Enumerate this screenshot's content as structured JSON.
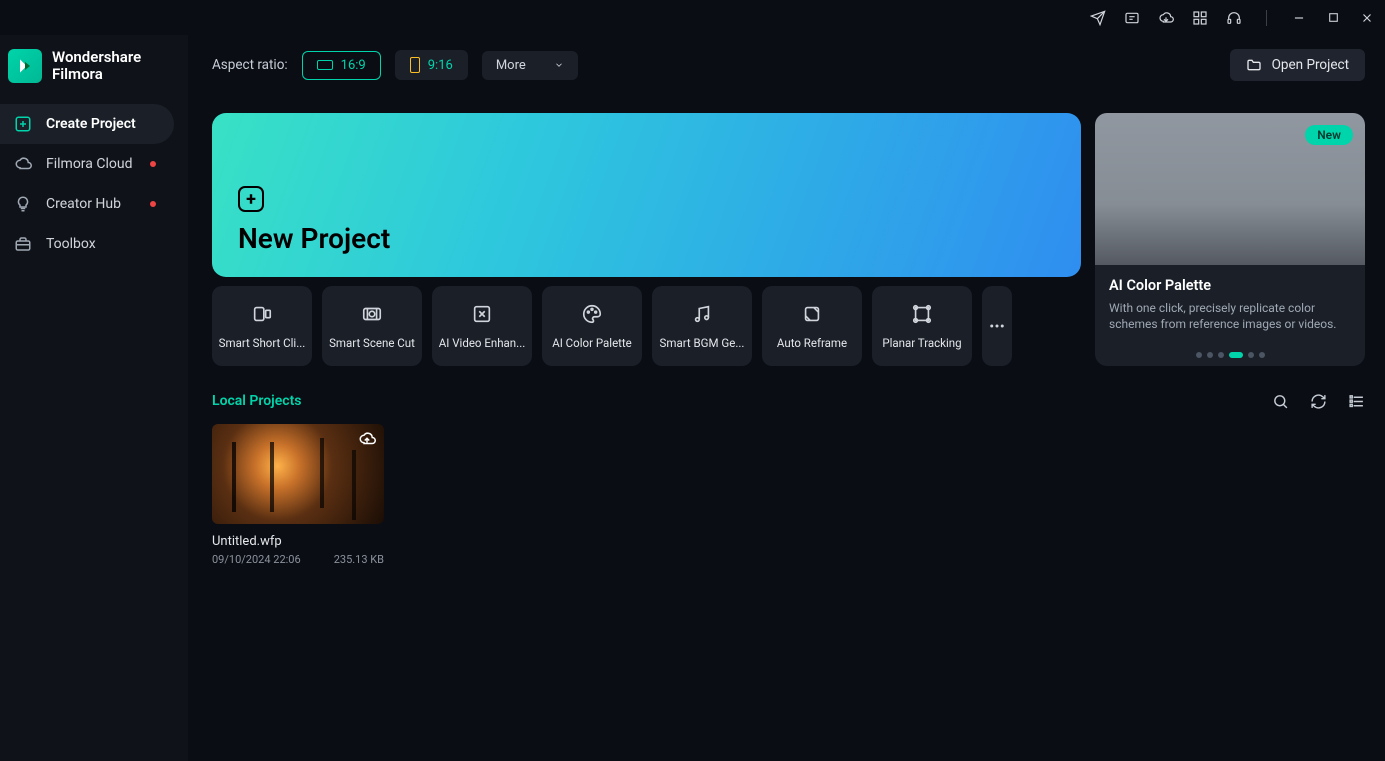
{
  "brand": {
    "line1": "Wondershare",
    "line2": "Filmora"
  },
  "sidebar": {
    "items": [
      {
        "label": "Create Project"
      },
      {
        "label": "Filmora Cloud"
      },
      {
        "label": "Creator Hub"
      },
      {
        "label": "Toolbox"
      }
    ]
  },
  "toolbar": {
    "aspect_label": "Aspect ratio:",
    "ratio_16_9": "16:9",
    "ratio_9_16": "9:16",
    "more": "More",
    "open_project": "Open Project"
  },
  "hero": {
    "new_project": "New Project"
  },
  "feature": {
    "badge": "New",
    "title": "AI Color Palette",
    "desc": "With one click, precisely replicate color schemes from reference images or videos."
  },
  "tools": [
    {
      "label": "Smart Short Cli..."
    },
    {
      "label": "Smart Scene Cut"
    },
    {
      "label": "AI Video Enhan..."
    },
    {
      "label": "AI Color Palette"
    },
    {
      "label": "Smart BGM Ge..."
    },
    {
      "label": "Auto Reframe"
    },
    {
      "label": "Planar Tracking"
    }
  ],
  "section": {
    "local_projects": "Local Projects"
  },
  "projects": [
    {
      "name": "Untitled.wfp",
      "date": "09/10/2024 22:06",
      "size": "235.13 KB"
    }
  ]
}
